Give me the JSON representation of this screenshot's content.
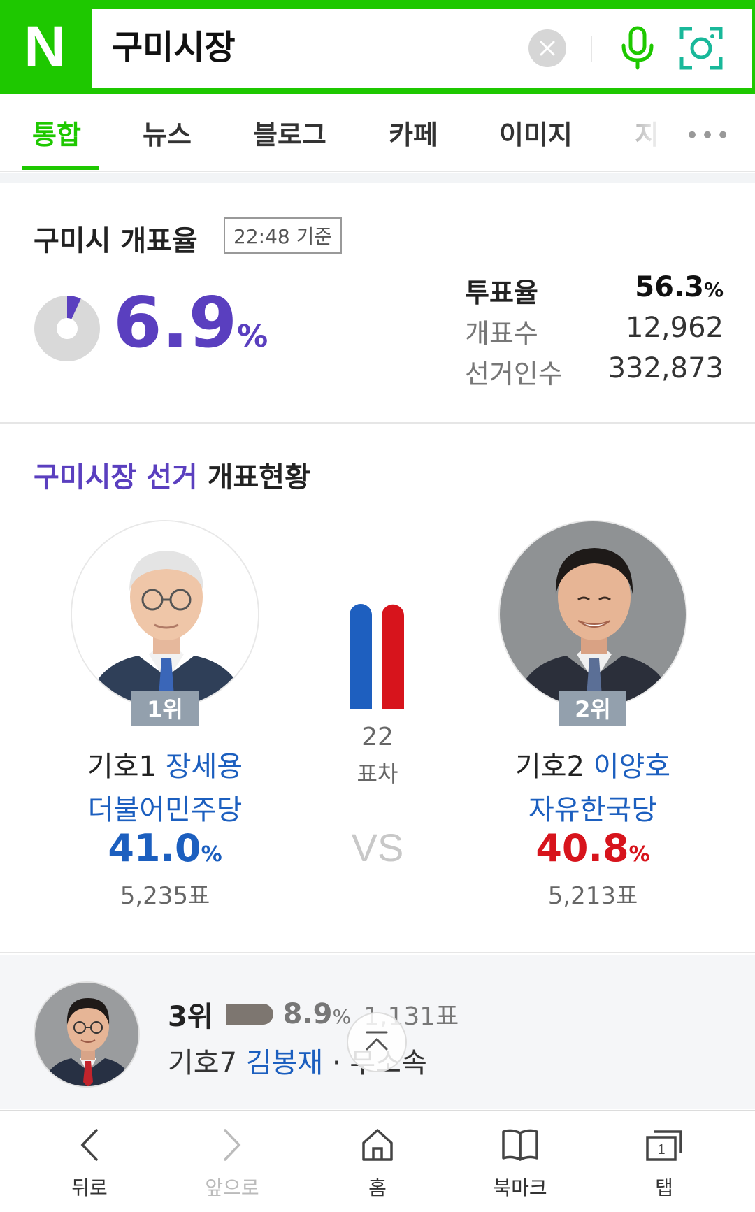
{
  "header": {
    "logo": "N",
    "search_value": "구미시장",
    "icons": [
      "clear-icon",
      "mic-icon",
      "smart-lens-icon"
    ],
    "accent_color": "#1ec800"
  },
  "tabs": {
    "items": [
      {
        "label": "통합",
        "active": true
      },
      {
        "label": "뉴스"
      },
      {
        "label": "블로그"
      },
      {
        "label": "카페"
      },
      {
        "label": "이미지"
      },
      {
        "label": "지"
      }
    ],
    "more": "•••"
  },
  "turnout": {
    "title": "구미시 개표율",
    "time": "22:48 기준",
    "counting_rate": "6.9",
    "counting_rate_unit": "%",
    "counting_fraction": 0.069,
    "stats": [
      {
        "label": "투표율",
        "value": "56.3",
        "unit": "%"
      },
      {
        "label": "개표수",
        "value": "12,962"
      },
      {
        "label": "선거인수",
        "value": "332,873"
      }
    ],
    "rate_color": "#5a3fbf"
  },
  "election": {
    "title_blue": "구미시장 선거",
    "title_dark": "개표현황",
    "candidates": [
      {
        "rank": "1위",
        "number": "기호1",
        "name": "장세용",
        "party": "더불어민주당",
        "pct": "41.0",
        "unit": "%",
        "votes": "5,235표",
        "color": "#1c5fbf"
      },
      {
        "rank": "2위",
        "number": "기호2",
        "name": "이양호",
        "party": "자유한국당",
        "pct": "40.8",
        "unit": "%",
        "votes": "5,213표",
        "color": "#d7141c"
      }
    ],
    "gap": {
      "value": "22",
      "unit": "표차"
    },
    "vs": "VS",
    "bar_colors": {
      "left": "#1e5fbf",
      "right": "#d7141c"
    }
  },
  "third": {
    "rank": "3위",
    "pct": "8.9",
    "unit": "%",
    "votes": "1,131표",
    "number": "기호7",
    "name": "김봉재",
    "affiliation": "무소속"
  },
  "bottom_nav": {
    "items": [
      {
        "label": "뒤로",
        "icon": "back-icon"
      },
      {
        "label": "앞으로",
        "icon": "forward-icon",
        "disabled": true
      },
      {
        "label": "홈",
        "icon": "home-icon"
      },
      {
        "label": "북마크",
        "icon": "bookmark-icon"
      },
      {
        "label": "탭",
        "icon": "tabs-icon",
        "badge": "1"
      }
    ]
  }
}
